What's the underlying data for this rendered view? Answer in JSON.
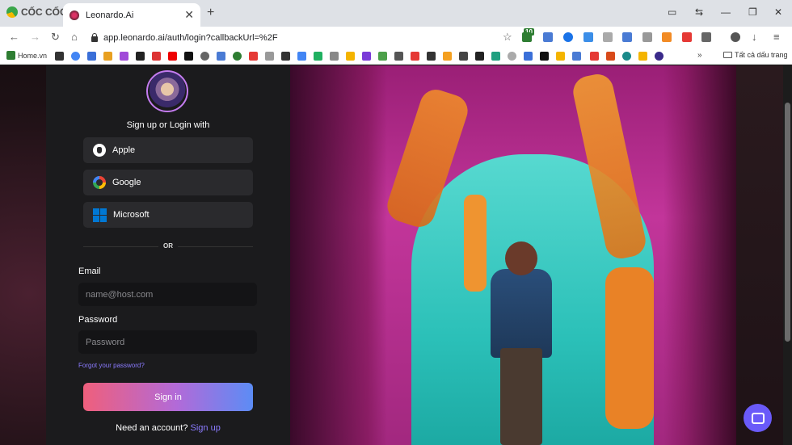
{
  "browser": {
    "brand": "CỐC CỐC",
    "tab_title": "Leonardo.Ai",
    "tab_close": "✕",
    "new_tab": "+",
    "url": "app.leonardo.ai/auth/login?callbackUrl=%2F",
    "ext_badge": "10",
    "bookmarks_home": "Home.vn",
    "bookmarks_more": "»",
    "bookmarks_folder": "Tất cả dấu trang"
  },
  "login": {
    "subtitle": "Sign up or Login with",
    "apple": "Apple",
    "google": "Google",
    "microsoft": "Microsoft",
    "or": "OR",
    "email_label": "Email",
    "email_placeholder": "name@host.com",
    "password_label": "Password",
    "password_placeholder": "Password",
    "forgot": "Forgot your password?",
    "signin": "Sign in",
    "need_account": "Need an account?",
    "signup": "Sign up"
  },
  "colors": {
    "accent": "#8b7bff",
    "signin_start": "#ef5f7c",
    "signin_end": "#5c8cf5",
    "chat": "#6a5af9"
  }
}
